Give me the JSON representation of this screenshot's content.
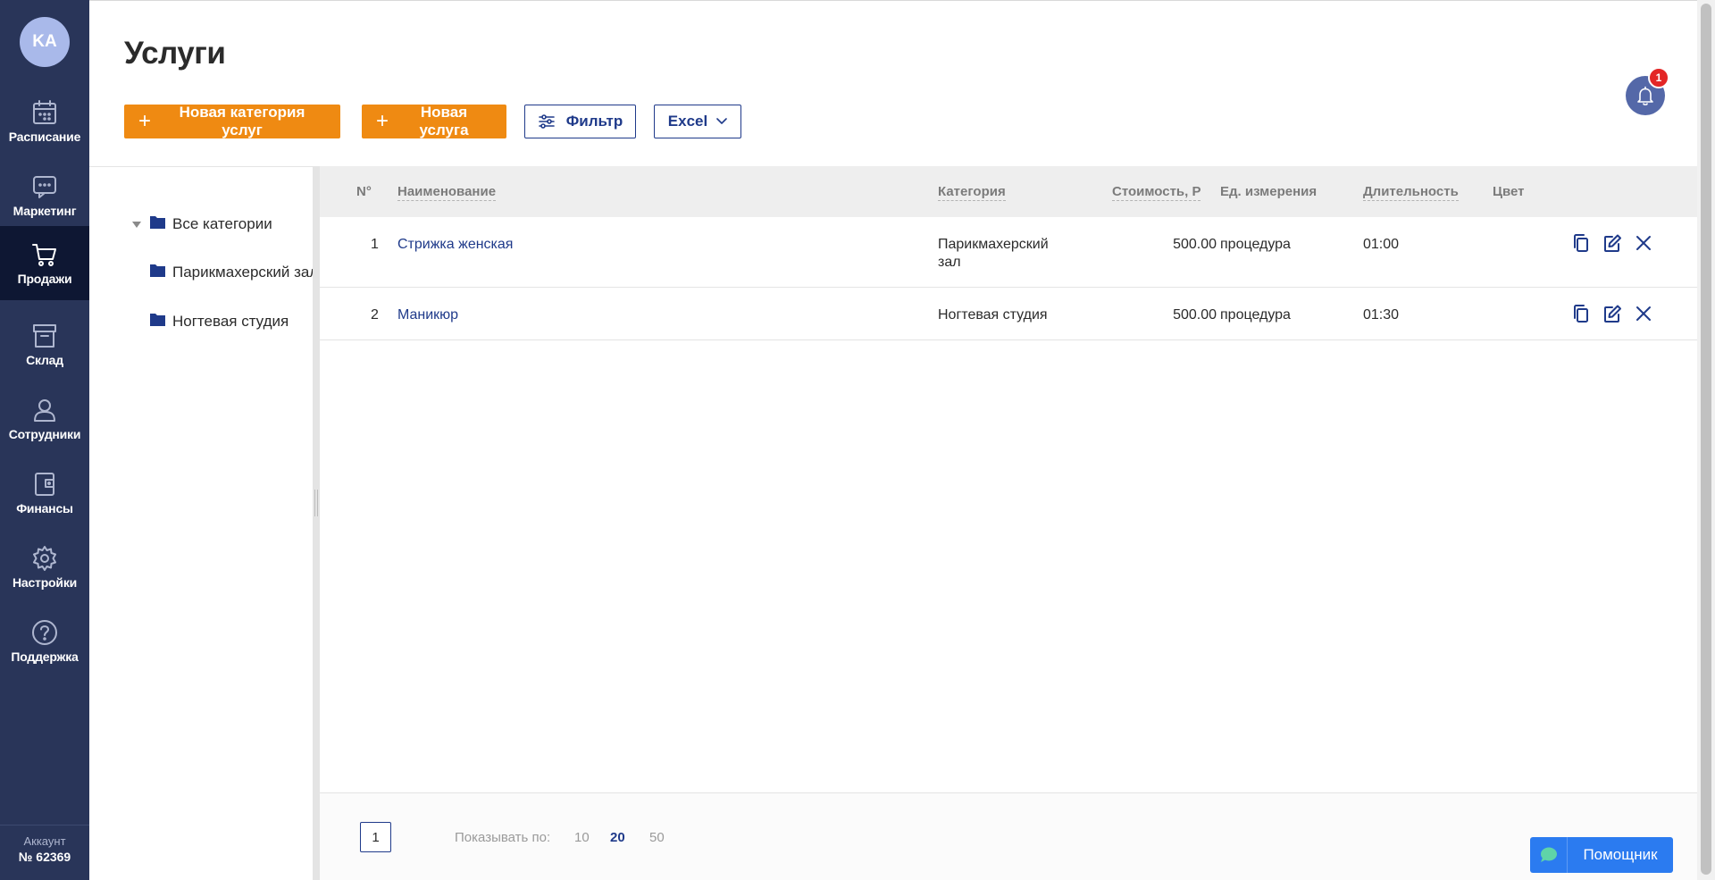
{
  "sidebar": {
    "avatar": "KA",
    "items": [
      {
        "label": "Расписание",
        "icon": "calendar-icon"
      },
      {
        "label": "Маркетинг",
        "icon": "chat-icon"
      },
      {
        "label": "Продажи",
        "icon": "cart-icon"
      },
      {
        "label": "Склад",
        "icon": "archive-icon"
      },
      {
        "label": "Сотрудники",
        "icon": "person-icon"
      },
      {
        "label": "Финансы",
        "icon": "wallet-icon"
      },
      {
        "label": "Настройки",
        "icon": "gear-icon"
      },
      {
        "label": "Поддержка",
        "icon": "help-icon"
      }
    ],
    "active": "Продажи",
    "account_title": "Аккаунт",
    "account_number": "№ 62369"
  },
  "header": {
    "title": "Услуги",
    "new_category_button": "Новая категория услуг",
    "new_service_button": "Новая услуга",
    "filter_button": "Фильтр",
    "excel_button": "Excel",
    "notifications_count": "1"
  },
  "tree": {
    "root": "Все категории",
    "children": [
      "Парикмахерский зал",
      "Ногтевая студия"
    ]
  },
  "table": {
    "columns": [
      "N°",
      "Наименование",
      "Категория",
      "Стоимость, Р",
      "Ед. измерения",
      "Длительность",
      "Цвет"
    ],
    "rows": [
      {
        "num": "1",
        "name": "Стрижка женская",
        "category_line1": "Парикмахерский",
        "category_line2": "зал",
        "price": "500.00",
        "unit": "процедура",
        "duration": "01:00"
      },
      {
        "num": "2",
        "name": "Маникюр",
        "category_line1": "Ногтевая студия",
        "category_line2": "",
        "price": "500.00",
        "unit": "процедура",
        "duration": "01:30"
      }
    ]
  },
  "footer": {
    "current_page": "1",
    "show_label": "Показывать по:",
    "per_page_options": [
      "10",
      "20",
      "50"
    ],
    "per_page_selected": "20"
  },
  "helper_button": "Помощник",
  "colors": {
    "sidebar_bg": "#293559",
    "sidebar_active": "#0e1733",
    "accent_orange": "#ef8a12",
    "primary_blue": "#1f3a8a",
    "helper_blue": "#2b7bf0"
  }
}
